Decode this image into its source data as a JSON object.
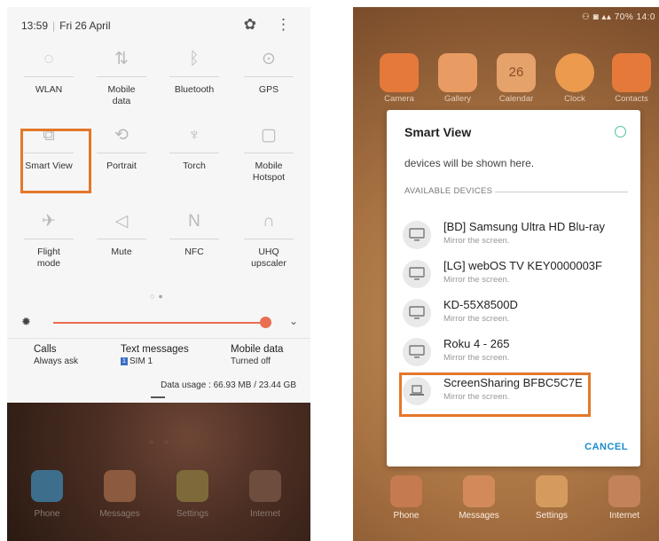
{
  "left": {
    "status": {
      "time": "13:59",
      "date": "Fri 26 April"
    },
    "tiles": [
      {
        "label": "WLAN",
        "icon": "wifi-icon",
        "glyph": "◌"
      },
      {
        "label": "Mobile data",
        "icon": "mobile-data-icon",
        "glyph": "⇅"
      },
      {
        "label": "Bluetooth",
        "icon": "bluetooth-icon",
        "glyph": "ᛒ"
      },
      {
        "label": "GPS",
        "icon": "location-pin-icon",
        "glyph": "⊙"
      },
      {
        "label": "Smart View",
        "icon": "smart-view-icon",
        "glyph": "⧉"
      },
      {
        "label": "Portrait",
        "icon": "rotation-icon",
        "glyph": "⟲"
      },
      {
        "label": "Torch",
        "icon": "torch-icon",
        "glyph": "♆"
      },
      {
        "label": "Mobile Hotspot",
        "icon": "hotspot-icon",
        "glyph": "▢"
      },
      {
        "label": "Flight mode",
        "icon": "airplane-icon",
        "glyph": "✈"
      },
      {
        "label": "Mute",
        "icon": "mute-icon",
        "glyph": "◁"
      },
      {
        "label": "NFC",
        "icon": "nfc-icon",
        "glyph": "N"
      },
      {
        "label": "UHQ upscaler",
        "icon": "headphones-icon",
        "glyph": "∩"
      }
    ],
    "brightness": 0.92,
    "calls": {
      "label": "Calls",
      "value": "Always ask"
    },
    "text_messages": {
      "label": "Text messages",
      "sim_badge": "1",
      "value": "SIM  1"
    },
    "mobile_data": {
      "label": "Mobile data",
      "value": "Turned off"
    },
    "data_usage": "Data usage : 66.93 MB / 23.44 GB",
    "dock": [
      "Phone",
      "Messages",
      "Settings",
      "Internet"
    ]
  },
  "right": {
    "status": "70% 14:0",
    "apps": [
      "Camera",
      "Gallery",
      "Calendar",
      "Clock",
      "Contacts"
    ],
    "calendar_day": "26",
    "dialog": {
      "title": "Smart View",
      "partial_text": "devices will be shown here.",
      "section": "AVAILABLE DEVICES",
      "devices": [
        {
          "name": "[BD] Samsung Ultra HD Blu-ray",
          "desc": "Mirror the screen."
        },
        {
          "name": "[LG] webOS TV KEY0000003F",
          "desc": "Mirror the screen."
        },
        {
          "name": "KD-55X8500D",
          "desc": "Mirror the screen."
        },
        {
          "name": "Roku 4 - 265",
          "desc": "Mirror the screen."
        },
        {
          "name": "ScreenSharing BFBC5C7E",
          "desc": "Mirror the screen."
        }
      ],
      "cancel": "CANCEL"
    },
    "dock": [
      "Phone",
      "Messages",
      "Settings",
      "Internet"
    ]
  },
  "colors": {
    "highlight": "#e4772a",
    "accent_brightness": "#ea6e52",
    "cancel": "#1a8ccc"
  }
}
